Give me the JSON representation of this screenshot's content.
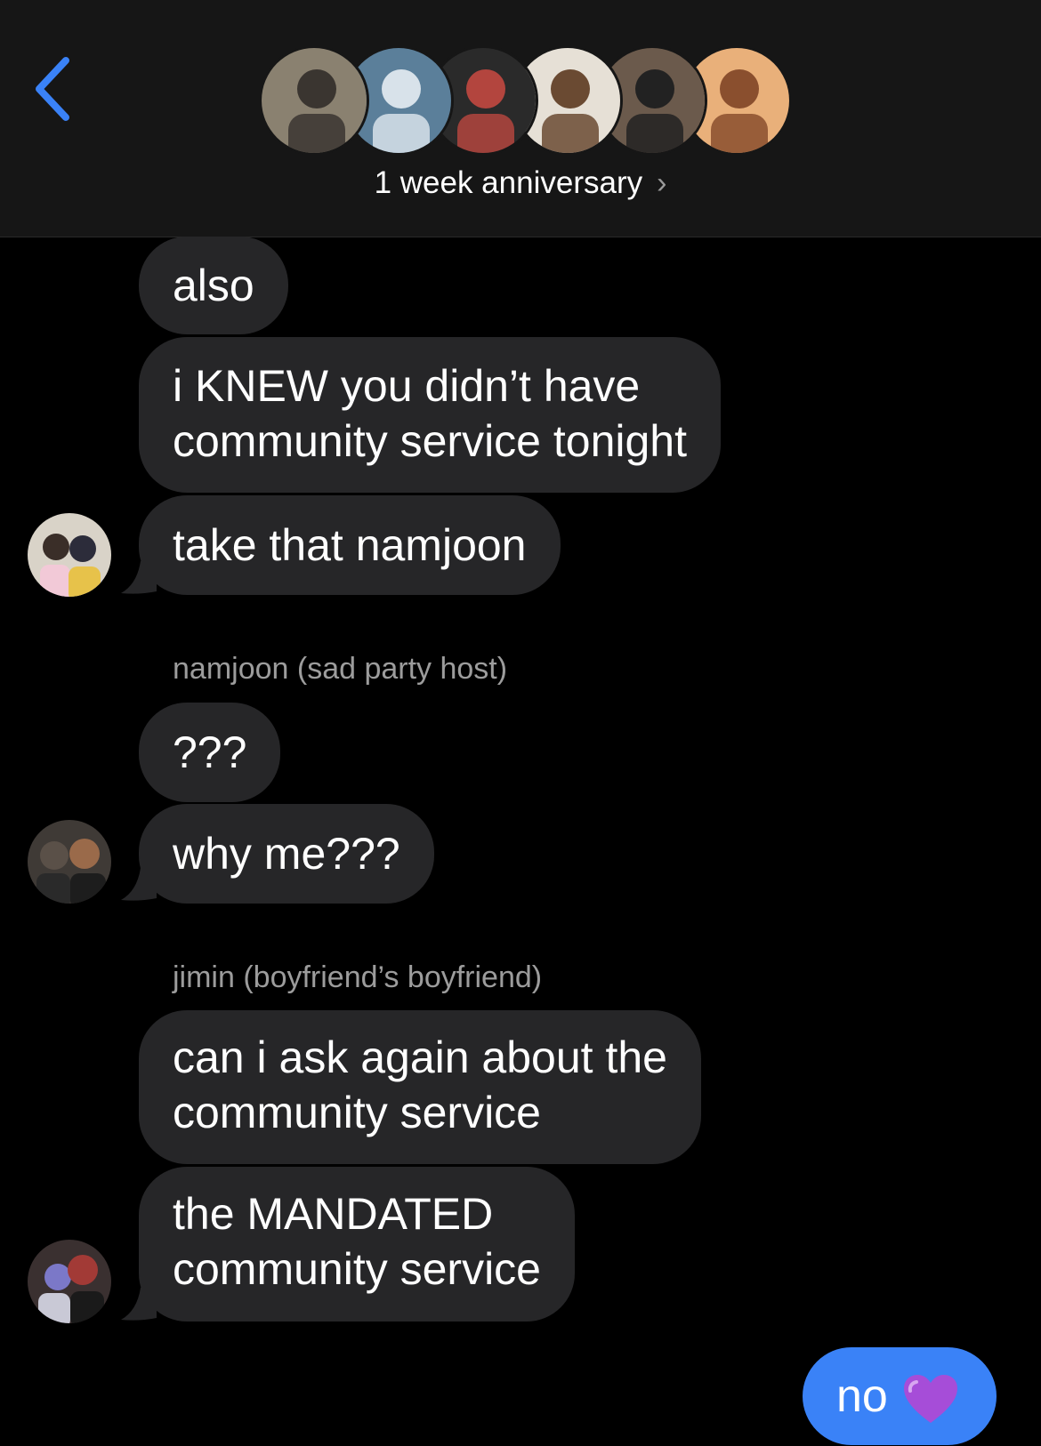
{
  "header": {
    "back_icon": "chevron-left-icon",
    "group_name": "1 week anniversary",
    "chevron_icon": "chevron-right-icon",
    "group_avatars": [
      {
        "name": "avatar-photo-1",
        "bg": "#8a8170",
        "fg": "#3a3530"
      },
      {
        "name": "avatar-photo-2",
        "bg": "#5b7f9a",
        "fg": "#d8e2ea"
      },
      {
        "name": "avatar-photo-3",
        "bg": "#2a2a2a",
        "fg": "#b3453e"
      },
      {
        "name": "avatar-photo-4",
        "bg": "#e6e0d6",
        "fg": "#6a4a32"
      },
      {
        "name": "avatar-photo-5",
        "bg": "#6b5a4c",
        "fg": "#222222"
      },
      {
        "name": "avatar-photo-6",
        "bg": "#e9b07a",
        "fg": "#8a4f2e"
      }
    ]
  },
  "messages": {
    "m1": "also",
    "m2": [
      "i KNEW you didn’t have",
      "community service tonight"
    ],
    "m3": "take that namjoon",
    "sender2": "namjoon (sad party host)",
    "m4": "???",
    "m5": "why me???",
    "sender3": "jimin (boyfriend’s boyfriend)",
    "m6": [
      "can i ask again about the",
      "community service"
    ],
    "m7": [
      "the MANDATED",
      "community service"
    ],
    "sent": "no",
    "sent_emoji": "purple-heart-icon"
  },
  "colors": {
    "incoming_bubble": "#262628",
    "outgoing_bubble": "#3a82f7",
    "back_chevron": "#3a82f7",
    "sender_text": "#9c9c9c",
    "heart": "#a64dd8"
  }
}
